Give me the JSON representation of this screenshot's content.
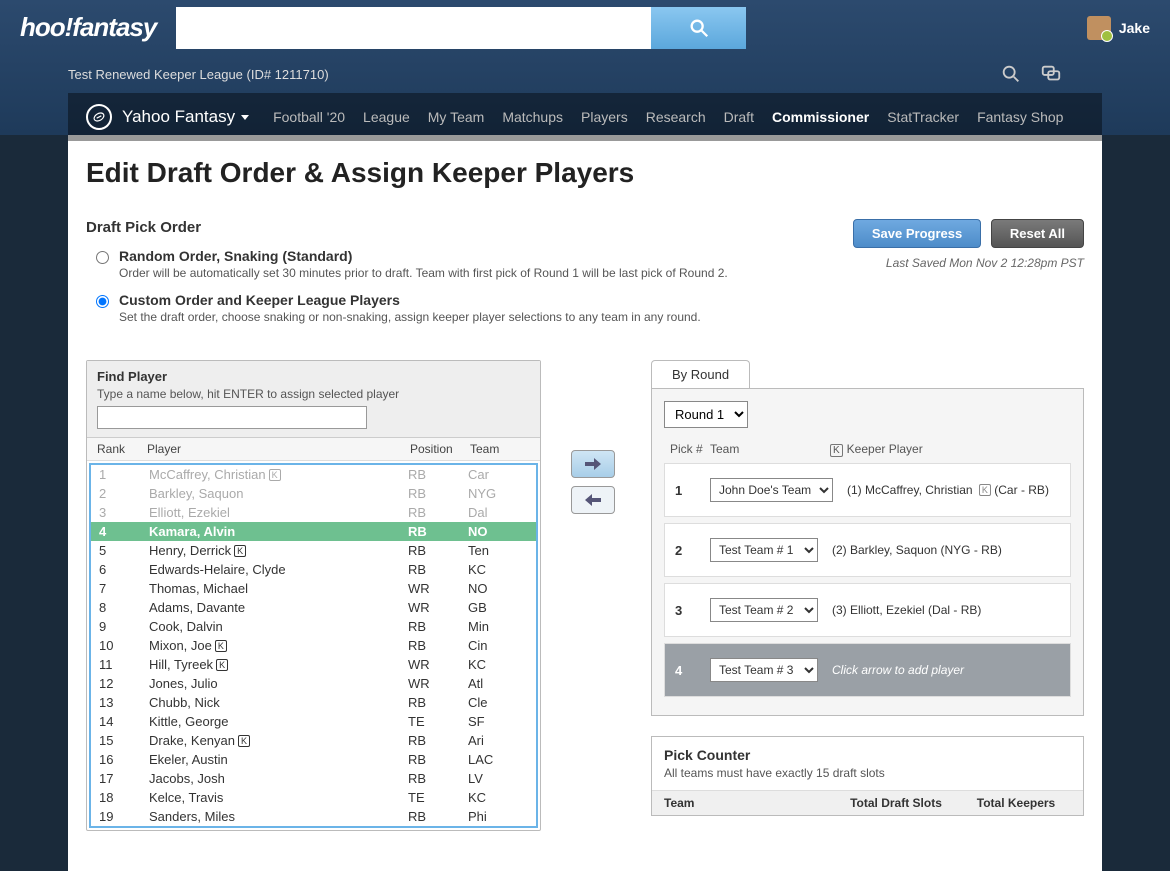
{
  "header": {
    "logo_text": "hoo!fantasy",
    "username": "Jake"
  },
  "league_label": "Test Renewed Keeper League (ID# 1211710)",
  "yf_label": "Yahoo Fantasy",
  "nav": [
    "Football '20",
    "League",
    "My Team",
    "Matchups",
    "Players",
    "Research",
    "Draft",
    "Commissioner",
    "StatTracker",
    "Fantasy Shop"
  ],
  "nav_active": 7,
  "page_title": "Edit Draft Order & Assign Keeper Players",
  "order": {
    "heading": "Draft Pick Order",
    "opt1_title": "Random Order, Snaking (Standard)",
    "opt1_desc": "Order will be automatically set 30 minutes prior to draft. Team with first pick of Round 1 will be last pick of Round 2.",
    "opt2_title": "Custom Order and Keeper League Players",
    "opt2_desc": "Set the draft order, choose snaking or non-snaking, assign keeper player selections to any team in any round.",
    "save_btn": "Save Progress",
    "reset_btn": "Reset All",
    "last_saved": "Last Saved Mon Nov 2 12:28pm PST"
  },
  "find_player": {
    "title": "Find Player",
    "hint": "Type a name below, hit ENTER to assign selected player",
    "cols": {
      "rank": "Rank",
      "player": "Player",
      "position": "Position",
      "team": "Team"
    },
    "rows": [
      {
        "rank": "1",
        "player": "McCaffrey, Christian",
        "k": true,
        "pos": "RB",
        "team": "Car",
        "assigned": true
      },
      {
        "rank": "2",
        "player": "Barkley, Saquon",
        "k": false,
        "pos": "RB",
        "team": "NYG",
        "assigned": true
      },
      {
        "rank": "3",
        "player": "Elliott, Ezekiel",
        "k": false,
        "pos": "RB",
        "team": "Dal",
        "assigned": true
      },
      {
        "rank": "4",
        "player": "Kamara, Alvin",
        "k": false,
        "pos": "RB",
        "team": "NO",
        "selected": true
      },
      {
        "rank": "5",
        "player": "Henry, Derrick",
        "k": true,
        "pos": "RB",
        "team": "Ten"
      },
      {
        "rank": "6",
        "player": "Edwards-Helaire, Clyde",
        "k": false,
        "pos": "RB",
        "team": "KC"
      },
      {
        "rank": "7",
        "player": "Thomas, Michael",
        "k": false,
        "pos": "WR",
        "team": "NO"
      },
      {
        "rank": "8",
        "player": "Adams, Davante",
        "k": false,
        "pos": "WR",
        "team": "GB"
      },
      {
        "rank": "9",
        "player": "Cook, Dalvin",
        "k": false,
        "pos": "RB",
        "team": "Min"
      },
      {
        "rank": "10",
        "player": "Mixon, Joe",
        "k": true,
        "pos": "RB",
        "team": "Cin"
      },
      {
        "rank": "11",
        "player": "Hill, Tyreek",
        "k": true,
        "pos": "WR",
        "team": "KC"
      },
      {
        "rank": "12",
        "player": "Jones, Julio",
        "k": false,
        "pos": "WR",
        "team": "Atl"
      },
      {
        "rank": "13",
        "player": "Chubb, Nick",
        "k": false,
        "pos": "RB",
        "team": "Cle"
      },
      {
        "rank": "14",
        "player": "Kittle, George",
        "k": false,
        "pos": "TE",
        "team": "SF"
      },
      {
        "rank": "15",
        "player": "Drake, Kenyan",
        "k": true,
        "pos": "RB",
        "team": "Ari"
      },
      {
        "rank": "16",
        "player": "Ekeler, Austin",
        "k": false,
        "pos": "RB",
        "team": "LAC"
      },
      {
        "rank": "17",
        "player": "Jacobs, Josh",
        "k": false,
        "pos": "RB",
        "team": "LV"
      },
      {
        "rank": "18",
        "player": "Kelce, Travis",
        "k": false,
        "pos": "TE",
        "team": "KC"
      },
      {
        "rank": "19",
        "player": "Sanders, Miles",
        "k": false,
        "pos": "RB",
        "team": "Phi"
      }
    ]
  },
  "by_round": {
    "tab": "By Round",
    "round_label": "Round 1",
    "cols": {
      "pick": "Pick #",
      "team": "Team",
      "keeper": "Keeper Player"
    },
    "picks": [
      {
        "num": "1",
        "team": "John Doe's Team",
        "text": "(1) McCaffrey, Christian",
        "badge": true,
        "suffix": "(Car - RB)"
      },
      {
        "num": "2",
        "team": "Test Team # 1",
        "text": "(2) Barkley, Saquon (NYG - RB)"
      },
      {
        "num": "3",
        "team": "Test Team # 2",
        "text": "(3) Elliott, Ezekiel (Dal - RB)"
      },
      {
        "num": "4",
        "team": "Test Team # 3",
        "text": "Click arrow to add player",
        "active": true
      }
    ]
  },
  "pick_counter": {
    "title": "Pick Counter",
    "desc": "All teams must have exactly 15 draft slots",
    "cols": {
      "team": "Team",
      "slots": "Total Draft Slots",
      "keepers": "Total Keepers"
    }
  }
}
